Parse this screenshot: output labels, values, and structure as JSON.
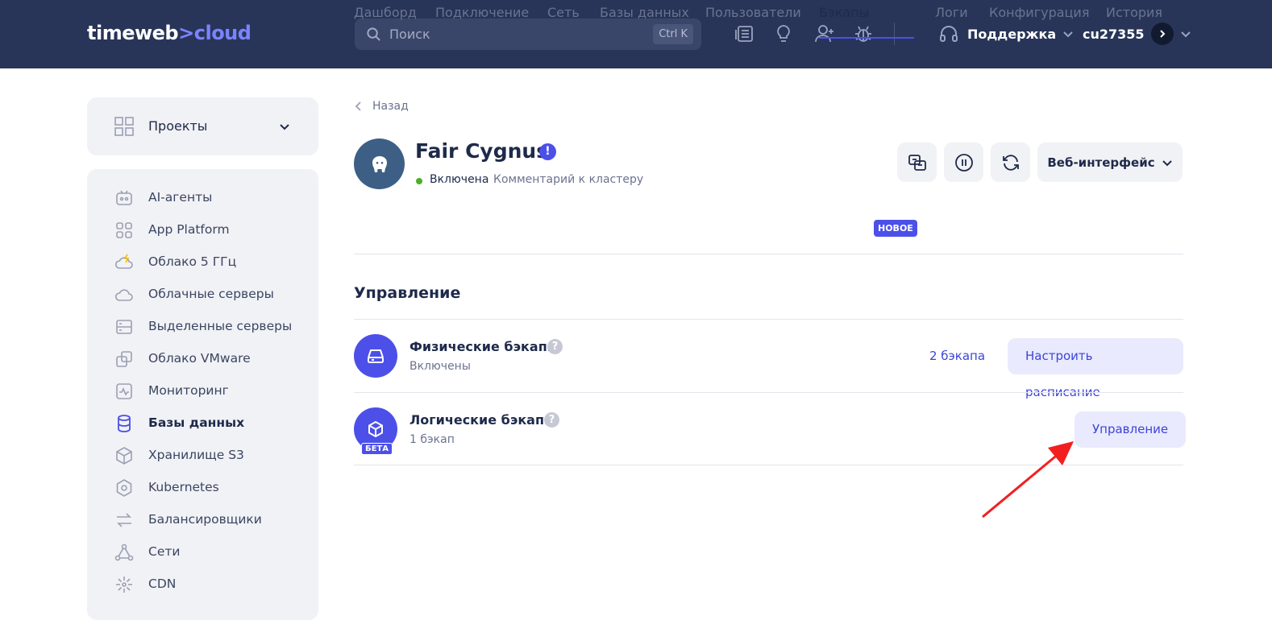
{
  "header": {
    "logo_main": "timeweb",
    "logo_sep": ">",
    "logo_accent": "cloud",
    "search_placeholder": "Поиск",
    "search_shortcut": "Ctrl K",
    "support_label": "Поддержка",
    "username": "cu27355"
  },
  "sidebar": {
    "projects_label": "Проекты",
    "items": [
      {
        "label": "AI-агенты",
        "icon": "robot-icon"
      },
      {
        "label": "App Platform",
        "icon": "apps-grid-icon"
      },
      {
        "label": "Облако 5 ГГц",
        "icon": "cloud-lightning-icon"
      },
      {
        "label": "Облачные серверы",
        "icon": "cloud-icon"
      },
      {
        "label": "Выделенные серверы",
        "icon": "server-icon"
      },
      {
        "label": "Облако VMware",
        "icon": "vmware-icon"
      },
      {
        "label": "Мониторинг",
        "icon": "monitoring-icon"
      },
      {
        "label": "Базы данных",
        "icon": "database-icon"
      },
      {
        "label": "Хранилище S3",
        "icon": "storage-box-icon"
      },
      {
        "label": "Kubernetes",
        "icon": "kubernetes-icon"
      },
      {
        "label": "Балансировщики",
        "icon": "balancer-arrows-icon"
      },
      {
        "label": "Сети",
        "icon": "network-icon"
      },
      {
        "label": "CDN",
        "icon": "cdn-icon"
      }
    ],
    "active_index": 7
  },
  "main": {
    "back_label": "Назад",
    "cluster_name": "Fair Cygnus",
    "warning_mark": "!",
    "status": "Включена",
    "comment": "Комментарий к кластеру",
    "web_interface_label": "Веб-интерфейс",
    "tabs": [
      "Дашборд",
      "Подключение",
      "Сеть",
      "Базы данных",
      "Пользователи",
      "Бэкапы",
      "Логи",
      "Конфигурация",
      "История"
    ],
    "active_tab": "Бэкапы",
    "new_badge": "НОВОЕ",
    "section_title": "Управление",
    "physical": {
      "title": "Физические бэкапы",
      "help": "?",
      "status": "Включены",
      "count": "2 бэкапа",
      "action": "Настроить расписание"
    },
    "logical": {
      "title": "Логические бэкапы",
      "help": "?",
      "status": "1 бэкап",
      "beta": "БЕТА",
      "action": "Управление"
    }
  },
  "colors": {
    "header_bg": "#283559",
    "accent": "#4c50e8",
    "annotation_arrow": "#f21f1f"
  }
}
